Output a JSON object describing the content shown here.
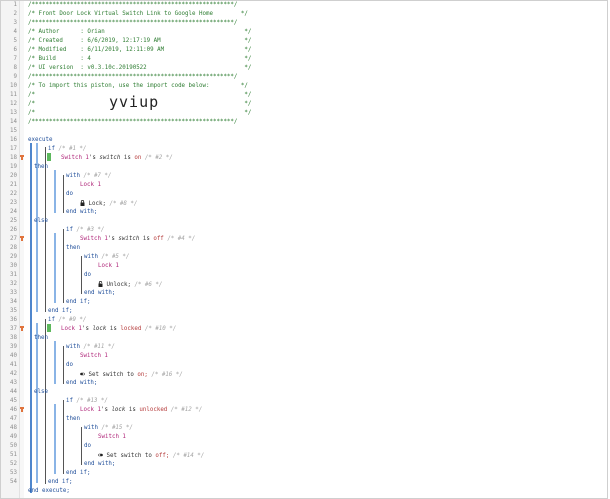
{
  "gutter": {
    "line_numbers": [
      "1",
      "2",
      "3",
      "4",
      "5",
      "6",
      "7",
      "8",
      "9",
      "10",
      "11",
      "12",
      "13",
      "14",
      "15",
      "16",
      "17",
      "18",
      "19",
      "20",
      "21",
      "22",
      "23",
      "24",
      "25",
      "26",
      "27",
      "28",
      "29",
      "30",
      "31",
      "32",
      "33",
      "34",
      "35",
      "36",
      "37",
      "38",
      "39",
      "40",
      "41",
      "42",
      "43",
      "44",
      "45",
      "46",
      "47",
      "48",
      "49",
      "50",
      "51",
      "52",
      "53",
      "54"
    ]
  },
  "header": {
    "l1": "/**********************************************************/",
    "l2": "/* Front Door Lock Virtual Switch Link to Google Home        */",
    "l3": "/**********************************************************/",
    "l4": "/* Author      : Orian                                        */",
    "l5": "/* Created     : 6/6/2019, 12:17:19 AM                        */",
    "l6": "/* Modified    : 6/11/2019, 12:11:09 AM                       */",
    "l7": "/* Build       : 4                                            */",
    "l8": "/* UI version  : v0.3.10c.20190522                            */",
    "l9": "/**********************************************************/",
    "l10": "/* To import this piston, use the import code below:         */",
    "l11": "/*                                                            */",
    "l12": "/*                                                            */",
    "l13": "/*                                                            */",
    "l14": "/**********************************************************/",
    "import_code": "yviup"
  },
  "code": {
    "execute": "execute",
    "if": "if",
    "then": "then",
    "with": "with",
    "do": "do",
    "else": "else",
    "end_with": "end with;",
    "end_if": "end if;",
    "end_execute": "end execute;",
    "c1": "/* #1 */",
    "c2": "/* #2 */",
    "c7": "/* #7 */",
    "c8": "/* #8 */",
    "c3": "/* #3 */",
    "c4": "/* #4 */",
    "c5": "/* #5 */",
    "c6": "/* #6 */",
    "c9": "/* #9 */",
    "c10": "/* #10 */",
    "c11": "/* #11 */",
    "c16": "/* #16 */",
    "c13": "/* #13 */",
    "c12": "/* #12 */",
    "c15": "/* #15 */",
    "c14": "/* #14 */",
    "switch1": "Switch 1",
    "lock1": "Lock 1",
    "s_switch": "'s ",
    "switch_attr": "switch",
    "lock_attr": "lock",
    "is": " is ",
    "on": "on",
    "off": "off",
    "locked": "locked",
    "unlocked": "unlocked",
    "lock_cmd": "Lock;",
    "unlock_cmd": "Unlock;",
    "set_switch_on": "Set switch to ",
    "set_switch_off": "Set switch to ",
    "on_semi": "on;",
    "off_semi": "off;"
  },
  "colors": {
    "keyword": "#1f4e9a",
    "device": "#b0277a",
    "value": "#b53b3b",
    "comment": "#a3a3a3",
    "header": "#2e7d32",
    "bar": "#8ab4e6",
    "condition": "#5cb85c"
  }
}
